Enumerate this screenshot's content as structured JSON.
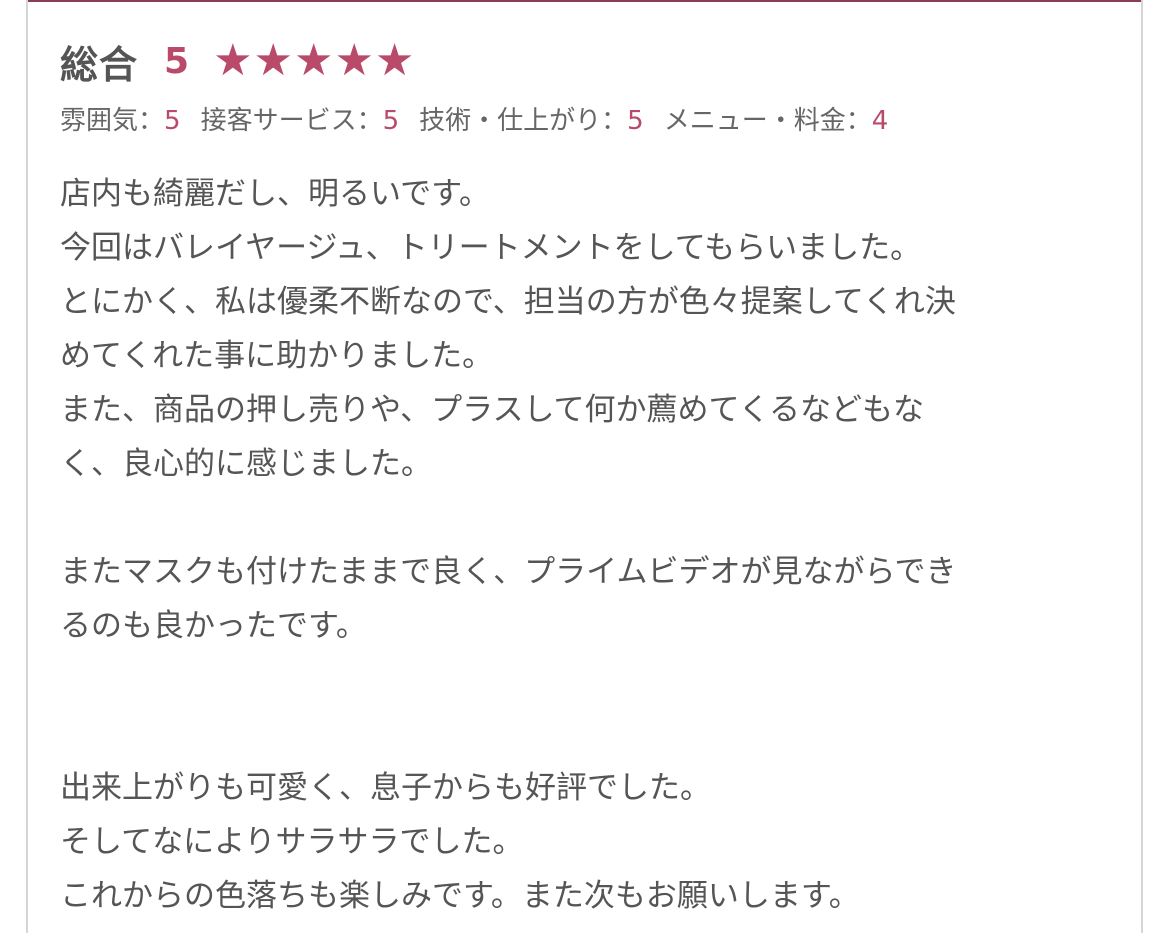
{
  "overall": {
    "label": "総合",
    "score": "5",
    "stars": 5,
    "max_stars": 5,
    "star_glyph": "★",
    "accent_color": "#b94a6a"
  },
  "subratings": [
    {
      "label": "雰囲気：",
      "value": "5"
    },
    {
      "label": "接客サービス：",
      "value": "5"
    },
    {
      "label": "技術・仕上がり：",
      "value": "5"
    },
    {
      "label": "メニュー・料金：",
      "value": "4"
    }
  ],
  "review": {
    "paragraph1": [
      "店内も綺麗だし、明るいです。",
      "今回はバレイヤージュ、トリートメントをしてもらいました。",
      "とにかく、私は優柔不断なので、担当の方が色々提案してくれ決",
      "めてくれた事に助かりました。",
      "また、商品の押し売りや、プラスして何か薦めてくるなどもな",
      "く、良心的に感じました。"
    ],
    "paragraph2": [
      "またマスクも付けたままで良く、プライムビデオが見ながらでき",
      "るのも良かったです。"
    ],
    "paragraph3": [
      "出来上がりも可愛く、息子からも好評でした。",
      "そしてなによりサラサラでした。",
      "これからの色落ちも楽しみです。また次もお願いします。"
    ]
  }
}
